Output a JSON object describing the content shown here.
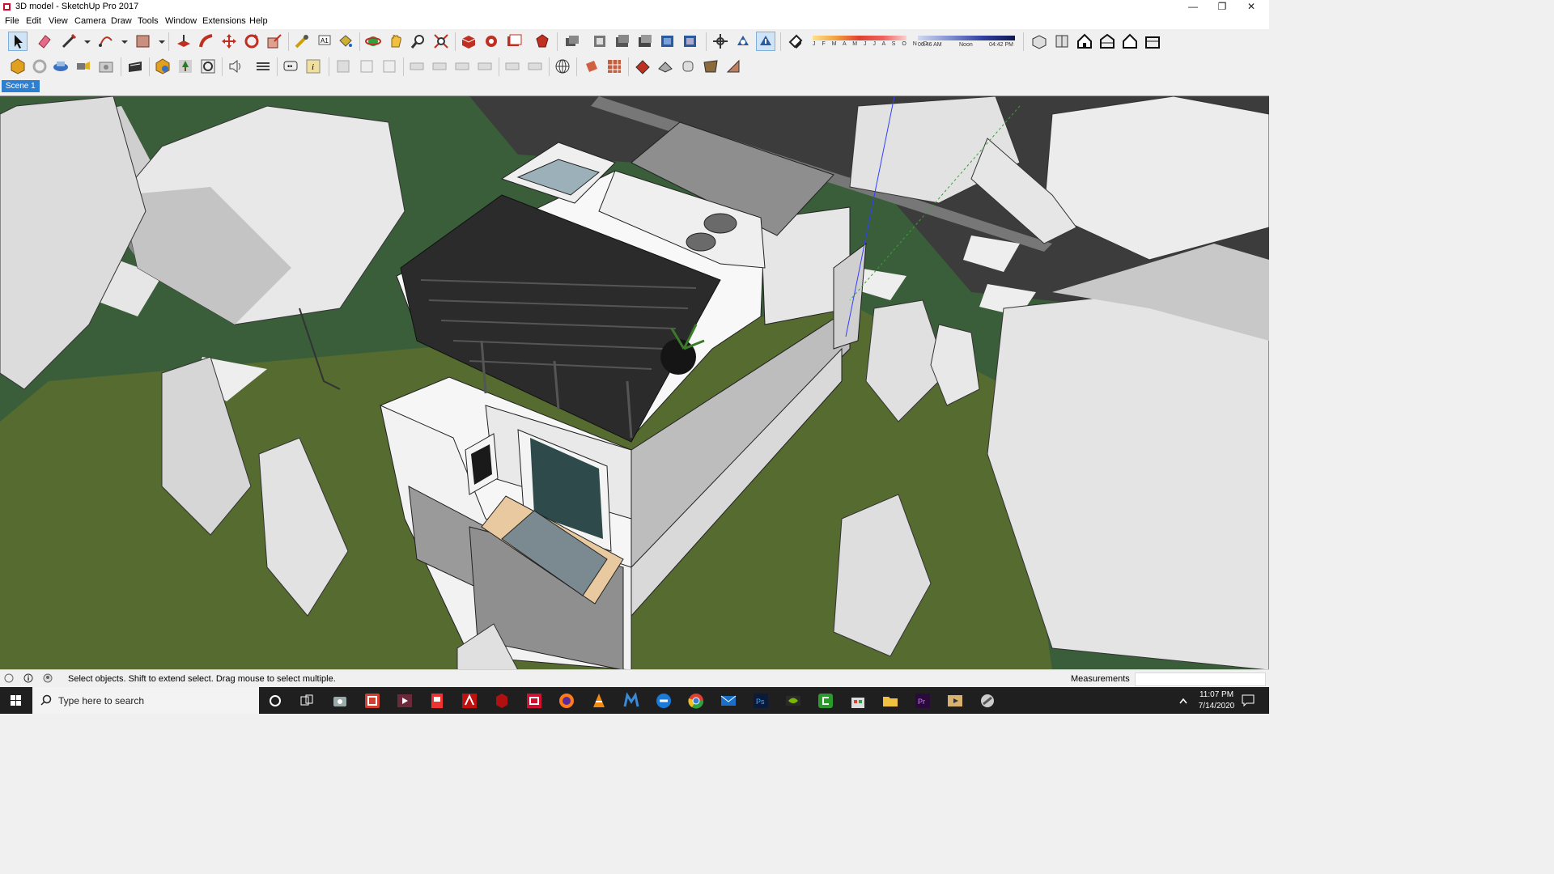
{
  "window": {
    "title": "3D model - SketchUp Pro 2017"
  },
  "menu": [
    "File",
    "Edit",
    "View",
    "Camera",
    "Draw",
    "Tools",
    "Window",
    "Extensions",
    "Help"
  ],
  "shadows": {
    "months": "J F M A M J J A S O N D",
    "time_start": "06:46 AM",
    "time_mid": "Noon",
    "time_end": "04:42 PM"
  },
  "scene": {
    "tab": "Scene 1"
  },
  "status": {
    "hint": "Select objects. Shift to extend select. Drag mouse to select multiple.",
    "measurements_label": "Measurements",
    "measurements_value": ""
  },
  "taskbar": {
    "search_placeholder": "Type here to search",
    "time": "11:07 PM",
    "date": "7/14/2020"
  },
  "icons": {
    "toolbar1": [
      "select-icon",
      "eraser-icon",
      "line-icon",
      "line-dropdown-icon",
      "arc-icon",
      "arc-dropdown-icon",
      "rectangle-icon",
      "rectangle-dropdown-icon",
      "push-pull-icon",
      "follow-me-icon",
      "move-icon",
      "rotate-icon",
      "scale-icon",
      "tape-measure-icon",
      "text-icon",
      "paint-bucket-icon",
      "orbit-icon",
      "pan-icon",
      "zoom-icon",
      "zoom-extents-icon",
      "3d-warehouse-icon",
      "extension-warehouse-icon",
      "layout-icon",
      "extension-manager-icon",
      "components-icon",
      "style-builder-icon",
      "get-photo-texture-icon",
      "add-location-icon",
      "toggle-terrain-icon",
      "position-camera-icon",
      "walk-icon",
      "look-around-icon",
      "shadows-toggle-icon",
      "iso-view-icon",
      "top-view-icon",
      "front-view-icon",
      "right-view-icon",
      "back-view-icon",
      "left-view-icon"
    ],
    "toolbar2": [
      "solid-tools-icon",
      "sandbox-icon",
      "dynamic-components-icon",
      "section-plane-icon",
      "advanced-camera-icon",
      "photo-texture-icon",
      "xray-icon",
      "preferences-icon",
      "styles-icon",
      "model-info-icon",
      "entity-info-icon",
      "sandbox-from-contours-icon",
      "sandbox-from-scratch-icon",
      "smoove-icon",
      "stamp-icon",
      "drape-icon",
      "add-detail-icon",
      "flip-edge-icon",
      "geo-location-icon"
    ]
  },
  "colors": {
    "ground_grass": "#3a5e3a",
    "lawn": "#556b2f",
    "road": "#3c3c3c",
    "selected_tab": "#2d7fd2",
    "axis_blue": "#3040ff",
    "axis_green": "#3aa03a"
  }
}
